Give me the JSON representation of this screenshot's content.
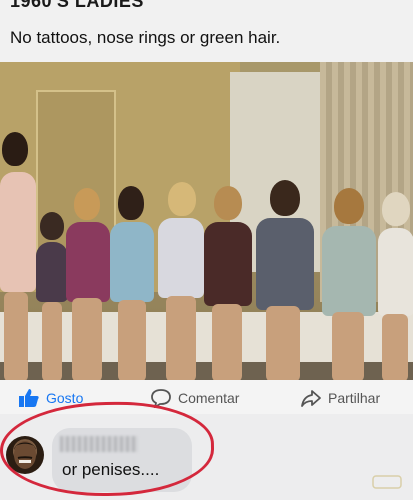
{
  "post": {
    "header_partial": "1960'S LADIES",
    "caption": "No tattoos, nose rings or green hair."
  },
  "actions": {
    "like_label": "Gosto",
    "comment_label": "Comentar",
    "share_label": "Partilhar",
    "like_color": "#1877f2"
  },
  "comment": {
    "text": "or penises....",
    "highlight_color": "#d4283c"
  }
}
